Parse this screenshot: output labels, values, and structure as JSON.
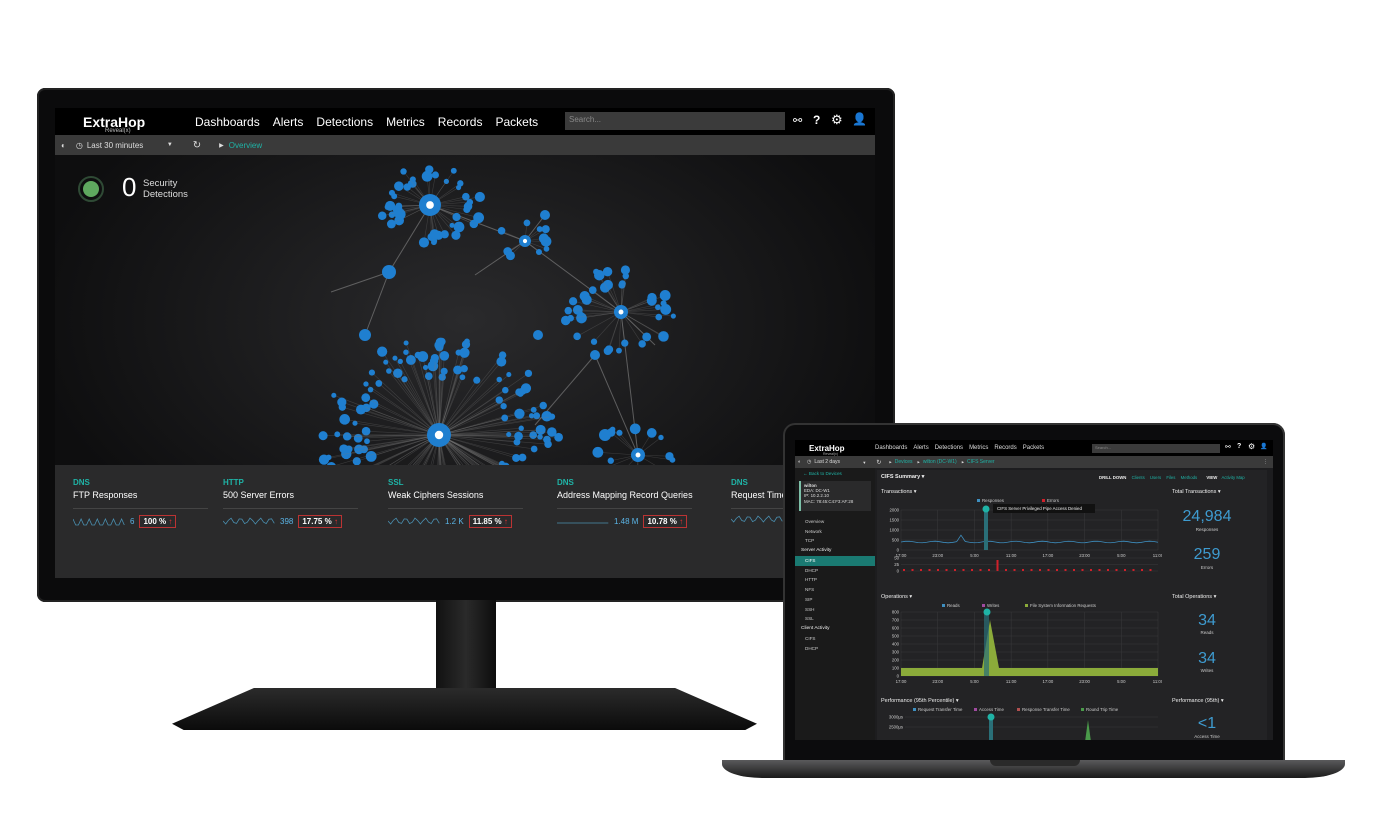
{
  "monitor": {
    "nav": {
      "logo": "ExtraHop",
      "logo_sub": "Reveal(x)",
      "items": [
        "Dashboards",
        "Alerts",
        "Detections",
        "Metrics",
        "Records",
        "Packets"
      ],
      "search_placeholder": "Search..."
    },
    "toolbar": {
      "time_range": "Last 30 minutes",
      "breadcrumb": "Overview"
    },
    "detections": {
      "count": "0",
      "label_line1": "Security",
      "label_line2": "Detections",
      "status_color": "#5fa85f"
    },
    "node_color": "#1f7fd0",
    "cards": [
      {
        "category": "DNS",
        "name": "FTP Responses",
        "value": "6",
        "percent": "100 %"
      },
      {
        "category": "HTTP",
        "name": "500 Server Errors",
        "value": "398",
        "percent": "17.75 %"
      },
      {
        "category": "SSL",
        "name": "Weak Ciphers Sessions",
        "value": "1.2 K",
        "percent": "11.85 %"
      },
      {
        "category": "DNS",
        "name": "Address Mapping Record Queries",
        "value": "1.48 M",
        "percent": "10.78 %"
      },
      {
        "category": "DNS",
        "name": "Request Time",
        "value": "",
        "percent": ""
      }
    ]
  },
  "laptop": {
    "nav": {
      "logo": "ExtraHop",
      "logo_sub": "Reveal(x)",
      "items": [
        "Dashboards",
        "Alerts",
        "Detections",
        "Metrics",
        "Records",
        "Packets"
      ],
      "active": "Metrics",
      "search_placeholder": "Search..."
    },
    "toolbar": {
      "time_range": "Last 2 days",
      "breadcrumb": [
        "Devices",
        "wilton (DC-W1)",
        "CIFS Server"
      ]
    },
    "sidebar": {
      "back": "Back to Devices",
      "device": {
        "name": "wilton",
        "eda": "EDA: DC-W1",
        "ip": "IP: 10.2.2.10",
        "mac": "MAC: 78:45:C4:F3:AF:28"
      },
      "items": [
        "Overview",
        "Network",
        "TCP"
      ],
      "server_heading": "Server Activity",
      "server_items": [
        "CIFS",
        "DHCP",
        "HTTP",
        "NFS",
        "SIP",
        "SSH",
        "SSL"
      ],
      "server_active": "CIFS",
      "client_heading": "Client Activity",
      "client_items": [
        "CIFS",
        "DHCP"
      ]
    },
    "summary_tab": "CIFS Summary",
    "drill_down": {
      "label": "DRILL DOWN",
      "links": [
        "Clients",
        "Users",
        "Files",
        "Methods"
      ]
    },
    "view": {
      "label": "VIEW",
      "link": "Activity Map"
    },
    "transactions": {
      "title": "Transactions",
      "legend": [
        "Responses",
        "Errors"
      ],
      "tooltip": "CIFS Server Privileged Pipe Access Denied",
      "y_ticks": [
        "2000",
        "1500",
        "1000",
        "500",
        "0"
      ],
      "err_ticks": [
        "50",
        "25",
        "0"
      ],
      "x_ticks": [
        "17:00",
        "23:00",
        "5:00",
        "11:00",
        "17:00",
        "23:00",
        "5:00",
        "11:00"
      ]
    },
    "total_transactions": {
      "title": "Total Transactions",
      "responses": "24,984",
      "responses_label": "Responses",
      "errors": "259",
      "errors_label": "Errors"
    },
    "operations": {
      "title": "Operations",
      "legend": [
        "Reads",
        "Writes",
        "File System Information Requests"
      ],
      "y_ticks": [
        "800",
        "700",
        "600",
        "500",
        "400",
        "300",
        "200",
        "100",
        "0"
      ],
      "x_ticks": [
        "17:00",
        "23:00",
        "5:00",
        "11:00",
        "17:00",
        "23:00",
        "5:00",
        "11:00"
      ]
    },
    "total_operations": {
      "title": "Total Operations",
      "reads": "34",
      "reads_label": "Reads",
      "writes": "34",
      "writes_label": "Writes"
    },
    "performance": {
      "title": "Performance (95th Percentile)",
      "legend": [
        "Request Transfer Time",
        "Access Time",
        "Response Transfer Time",
        "Round Trip Time"
      ],
      "y_ticks": [
        "3000µs",
        "2500µs"
      ]
    },
    "performance_95": {
      "title": "Performance (95th)",
      "value": "<1",
      "label": "Access Time"
    },
    "colors": {
      "accent": "#1fb3a6",
      "responses": "#3e8fc0",
      "errors": "#d0202a",
      "fs_requests": "#8bab3a",
      "writes": "#a04aa0"
    }
  }
}
